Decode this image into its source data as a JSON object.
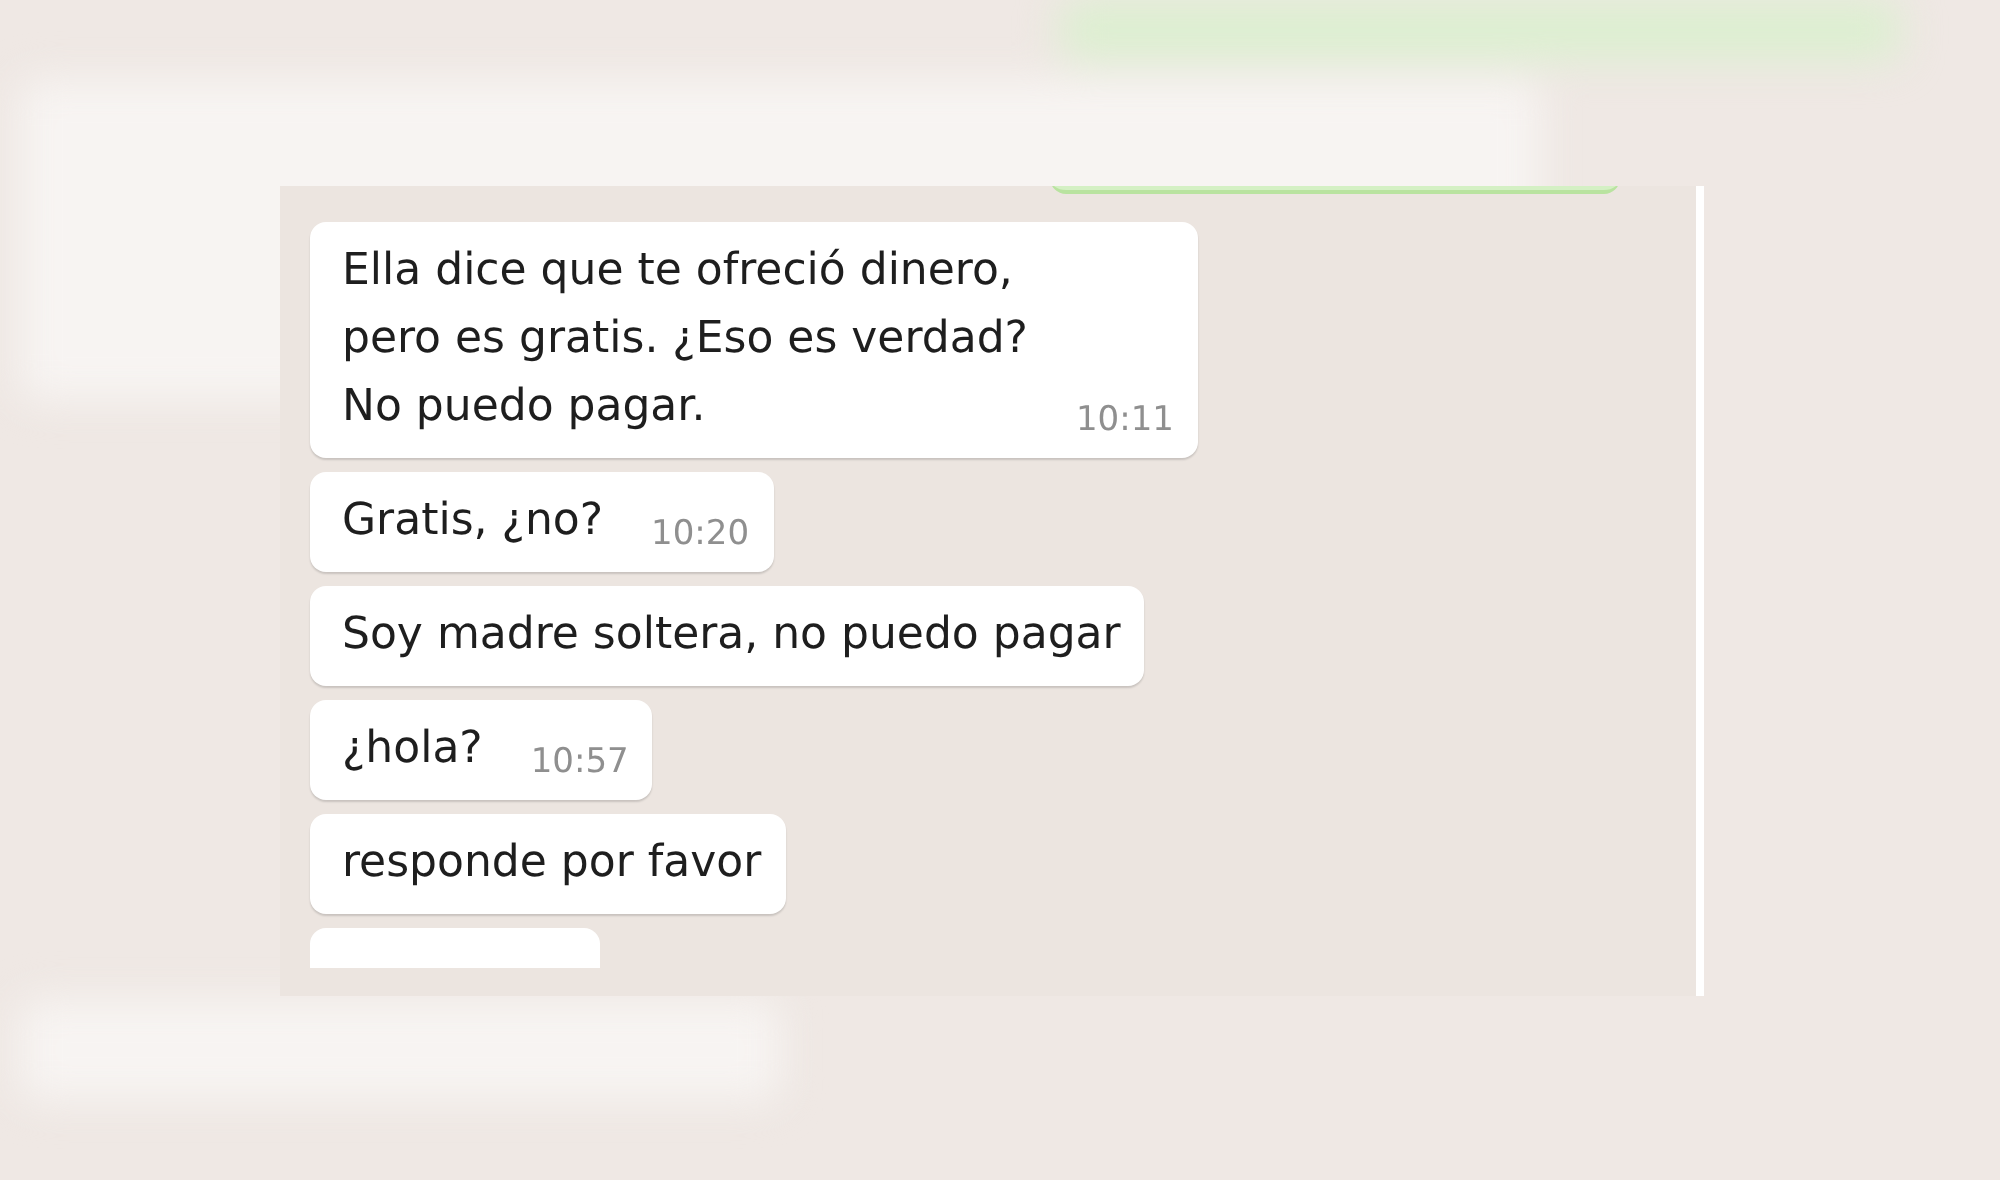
{
  "messages": [
    {
      "kind": "text",
      "text": "Ella dice que te ofreció dinero,\npero es gratis. ¿Eso es verdad?\nNo puedo pagar.",
      "time": "10:11"
    },
    {
      "kind": "text",
      "text": "Gratis, ¿no?",
      "time": "10:20"
    },
    {
      "kind": "text",
      "text": "Soy madre soltera, no puedo pagar"
    },
    {
      "kind": "text",
      "text": "¿hola?",
      "time": "10:57"
    },
    {
      "kind": "text",
      "text": "responde por favor"
    },
    {
      "kind": "partial"
    }
  ]
}
